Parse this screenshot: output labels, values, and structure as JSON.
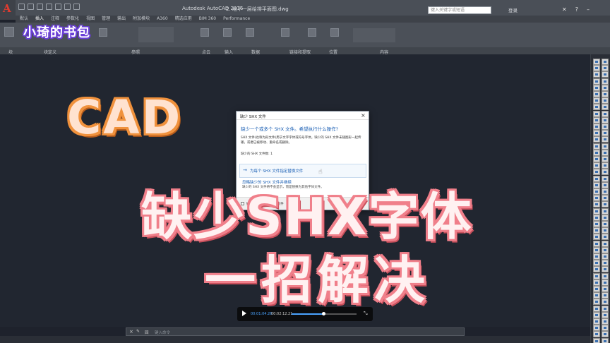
{
  "titlebar": {
    "app_title": "Autodesk AutoCAD 2016",
    "doc_title": "2.  地下一层给排平面图.dwg",
    "search_placeholder": "键入关键字或短语",
    "user": "登录",
    "help": "?"
  },
  "menu_tabs": [
    "默认",
    "插入",
    "注释",
    "参数化",
    "视图",
    "管理",
    "输出",
    "附加模块",
    "A360",
    "精选应用",
    "BIM 360",
    "Performance"
  ],
  "ribbon_panels": [
    "块",
    "块定义",
    "参照",
    "点云",
    "输入",
    "数据",
    "链接和提取",
    "位置",
    "内容"
  ],
  "watermark": "小琦的书包",
  "dialog": {
    "title": "缺少 SHX 文件",
    "close": "×",
    "question": "缺少一个或多个 SHX 文件。希望执行什么操作?",
    "body": "SHX 文件(也称为形文件)用于文字字体或符号字体。缺少的 SHX 文件未随图形一起传输，或者已被移动、重命名或删除。",
    "count_label": "缺少的 SHX 文件数: 1",
    "option1": "为每个 SHX 文件指定替换文件",
    "option2": "忽略缺少的 SHX 文件并继续",
    "option2_sub": "缺少的 SHX 文件将不会显示，而是替换为其他字体文件。",
    "footer": "始终忽略缺少的 SHX 文件"
  },
  "overlay": {
    "line0": "CAD",
    "line1": "缺少SHX字体",
    "line2": "一招解决"
  },
  "player": {
    "current_time": "00:01:04.26",
    "total_time": "00:02:12.21",
    "progress": 0.49
  },
  "command_line": {
    "close": "×",
    "prompt": "回",
    "placeholder": "键入命令"
  }
}
